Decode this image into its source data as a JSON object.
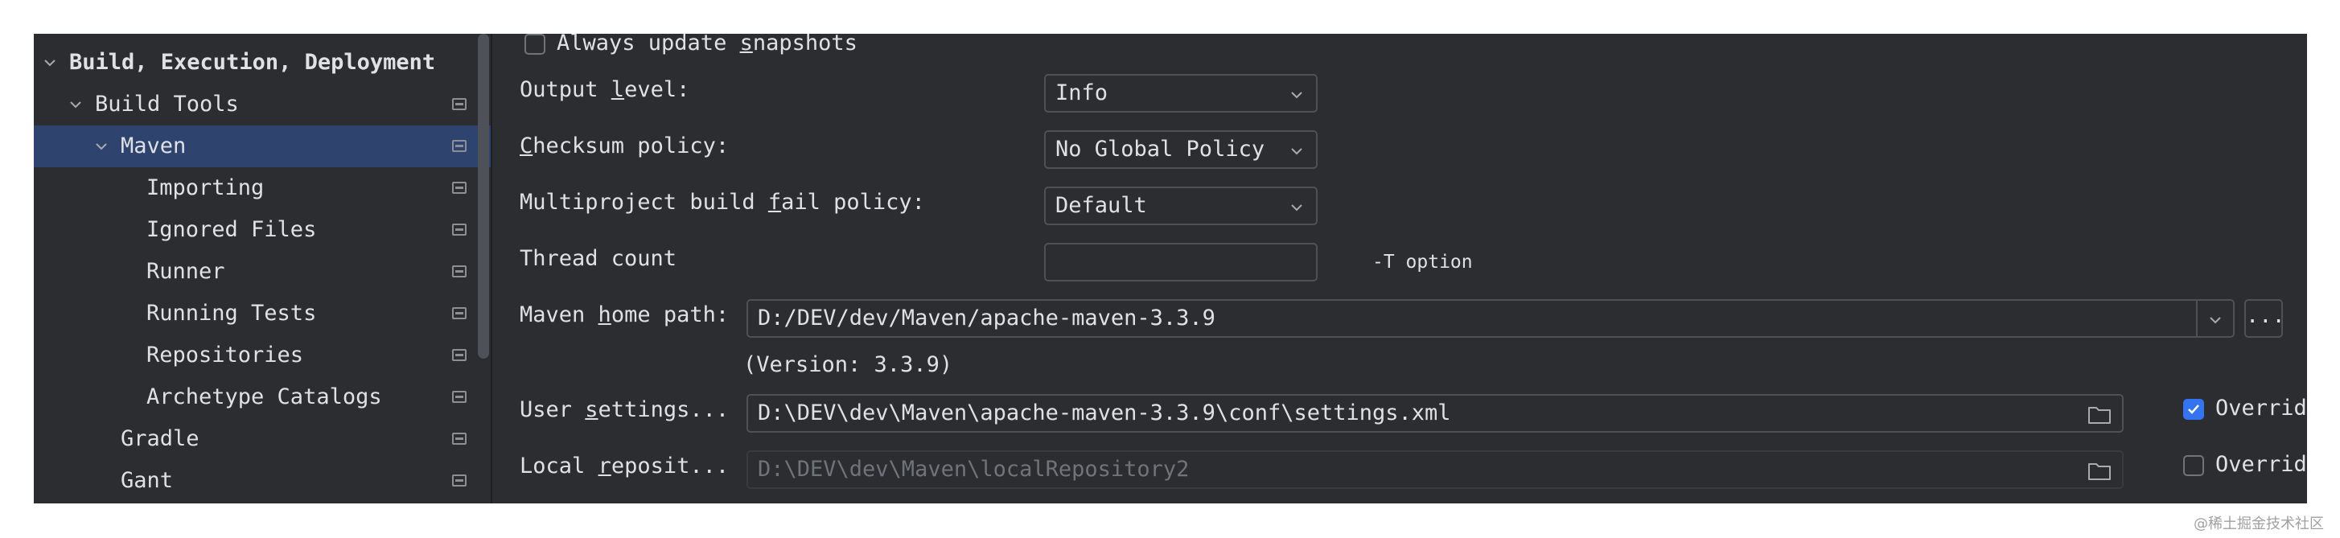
{
  "sidebar": {
    "items": [
      {
        "label": "Build, Execution, Deployment",
        "chevron": "chevron-down-icon",
        "bold": true
      },
      {
        "label": "Build Tools",
        "chevron": "chevron-down-icon"
      },
      {
        "label": "Maven",
        "chevron": "chevron-down-icon",
        "selected": true
      },
      {
        "label": "Importing"
      },
      {
        "label": "Ignored Files"
      },
      {
        "label": "Runner"
      },
      {
        "label": "Running Tests"
      },
      {
        "label": "Repositories"
      },
      {
        "label": "Archetype Catalogs"
      },
      {
        "label": "Gradle"
      },
      {
        "label": "Gant"
      }
    ]
  },
  "main": {
    "always_update": {
      "label_pre": "Always update ",
      "label_mnemonic": "s",
      "label_post": "napshots",
      "checked": false
    },
    "output_level": {
      "label_pre": "Output ",
      "label_mnemonic": "l",
      "label_post": "evel:",
      "value": "Info"
    },
    "checksum": {
      "label_pre": "",
      "label_mnemonic": "C",
      "label_post": "hecksum policy:",
      "value": "No Global Policy"
    },
    "multiproject": {
      "label_pre": "Multiproject build ",
      "label_mnemonic": "f",
      "label_post": "ail policy:",
      "value": "Default"
    },
    "thread_count": {
      "label": "Thread count",
      "value": "",
      "hint": "-T option"
    },
    "maven_home": {
      "label_pre": "Maven ",
      "label_mnemonic": "h",
      "label_post": "ome path:",
      "value": "D:/DEV/dev/Maven/apache-maven-3.3.9",
      "browse_label": "...",
      "version": "(Version: 3.3.9)"
    },
    "user_settings": {
      "label_pre": "User ",
      "label_mnemonic": "s",
      "label_post": "ettings...",
      "value": "D:\\DEV\\dev\\Maven\\apache-maven-3.3.9\\conf\\settings.xml",
      "override_label": "Override",
      "override_checked": true
    },
    "local_repo": {
      "label_pre": "Local ",
      "label_mnemonic": "r",
      "label_post": "eposit...",
      "value": "D:\\DEV\\dev\\Maven\\localRepository2",
      "override_label": "Override",
      "override_checked": false
    }
  },
  "watermark": "@稀土掘金技术社区",
  "colors": {
    "accent": "#3574f0",
    "selection": "#2e436e",
    "background": "#2b2d30"
  }
}
